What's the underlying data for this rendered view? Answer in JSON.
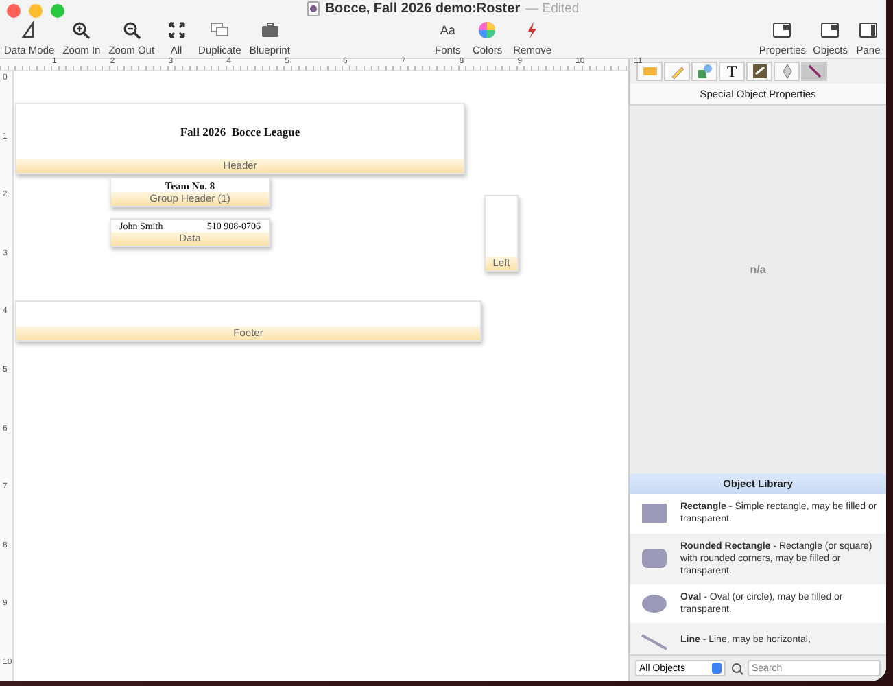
{
  "window": {
    "title": "Bocce, Fall 2026 demo:Roster",
    "status": "— Edited"
  },
  "toolbar": {
    "left": [
      {
        "label": "Data Mode"
      },
      {
        "label": "Zoom In"
      },
      {
        "label": "Zoom Out"
      },
      {
        "label": "All"
      },
      {
        "label": "Duplicate"
      },
      {
        "label": "Blueprint"
      }
    ],
    "middle": [
      {
        "label": "Fonts",
        "glyph": "Aa"
      },
      {
        "label": "Colors"
      },
      {
        "label": "Remove"
      }
    ],
    "right": [
      {
        "label": "Properties"
      },
      {
        "label": "Objects"
      },
      {
        "label": "Pane"
      }
    ]
  },
  "ruler": {
    "horizontal": [
      "1",
      "2",
      "3",
      "4",
      "5",
      "6",
      "7",
      "8",
      "9",
      "10",
      "11"
    ],
    "vertical": [
      "0",
      "1",
      "2",
      "3",
      "4",
      "5",
      "6",
      "7",
      "8",
      "9",
      "10"
    ]
  },
  "parts": [
    {
      "label": "Header",
      "fields": [
        {
          "text": "Fall 2026  Bocce League",
          "kind": "title"
        }
      ]
    },
    {
      "label": "Group Header (1)",
      "fields": [
        {
          "text": "Team No. 8",
          "kind": "title"
        }
      ]
    },
    {
      "label": "Data",
      "fields": [
        {
          "text": "John Smith",
          "kind": "plain"
        },
        {
          "text": "510 908-0706",
          "kind": "plain"
        }
      ]
    },
    {
      "label": "Left"
    },
    {
      "label": "Footer"
    }
  ],
  "panel": {
    "tabs": [
      {
        "selected": false
      },
      {
        "selected": false
      },
      {
        "selected": false
      },
      {
        "selected": false,
        "glyph": "T"
      },
      {
        "selected": false
      },
      {
        "selected": false
      },
      {
        "selected": true
      }
    ],
    "section_title": "Special Object Properties",
    "empty_text": "n/a",
    "library": {
      "title": "Object Library",
      "items": [
        {
          "text": "**Rectangle** - Simple rectangle, may be filled or transparent.",
          "kind": "rect"
        },
        {
          "text": "**Rounded Rectangle** - Rectangle (or square) with rounded corners, may be filled or transparent.",
          "kind": "rounded"
        },
        {
          "text": "**Oval** - Oval (or circle), may be filled or transparent.",
          "kind": "oval"
        },
        {
          "text": "**Line** - Line, may be horizontal,",
          "kind": "line"
        }
      ]
    },
    "filter": "All Objects",
    "search": {
      "placeholder": "Search"
    }
  }
}
